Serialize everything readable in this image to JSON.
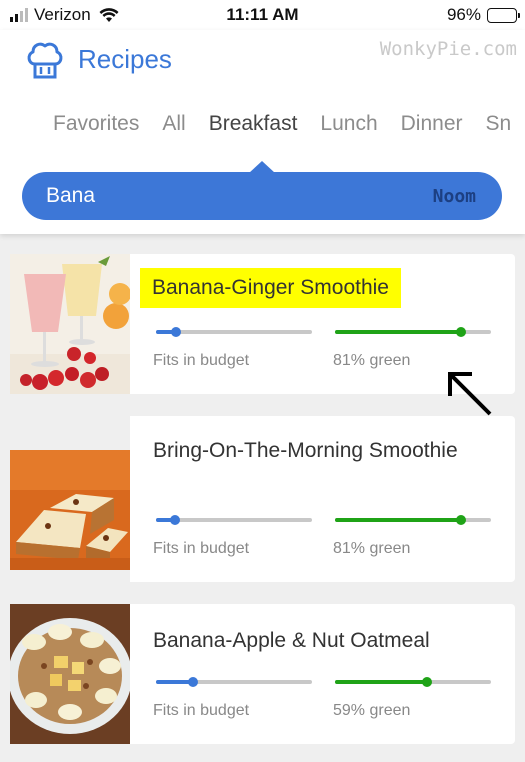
{
  "status": {
    "carrier": "Verizon",
    "time": "11:11 AM",
    "battery": "96%"
  },
  "header": {
    "app_title": "Recipes",
    "watermark": "WonkyPie.com",
    "tabs": [
      {
        "label": "Favorites",
        "active": false
      },
      {
        "label": "All",
        "active": false
      },
      {
        "label": "Breakfast",
        "active": true
      },
      {
        "label": "Lunch",
        "active": false
      },
      {
        "label": "Dinner",
        "active": false
      },
      {
        "label": "Sn",
        "active": false
      }
    ],
    "search": {
      "value": "Bana",
      "brand": "Noom"
    }
  },
  "colors": {
    "accent": "#3b78d8",
    "green": "#1fa317",
    "highlight": "#ffff00"
  },
  "recipes": [
    {
      "title": "Banana-Ginger Smoothie",
      "highlighted": true,
      "budget_label": "Fits in budget",
      "budget_fraction": 0.13,
      "green_label": "81% green",
      "green_fraction": 0.81
    },
    {
      "title": "Bring-On-The-Morning Smoothie",
      "highlighted": false,
      "budget_label": "Fits in budget",
      "budget_fraction": 0.12,
      "green_label": "81% green",
      "green_fraction": 0.81
    },
    {
      "title": "Banana-Apple & Nut Oatmeal",
      "highlighted": false,
      "budget_label": "Fits in budget",
      "budget_fraction": 0.24,
      "green_label": "59% green",
      "green_fraction": 0.59
    }
  ]
}
